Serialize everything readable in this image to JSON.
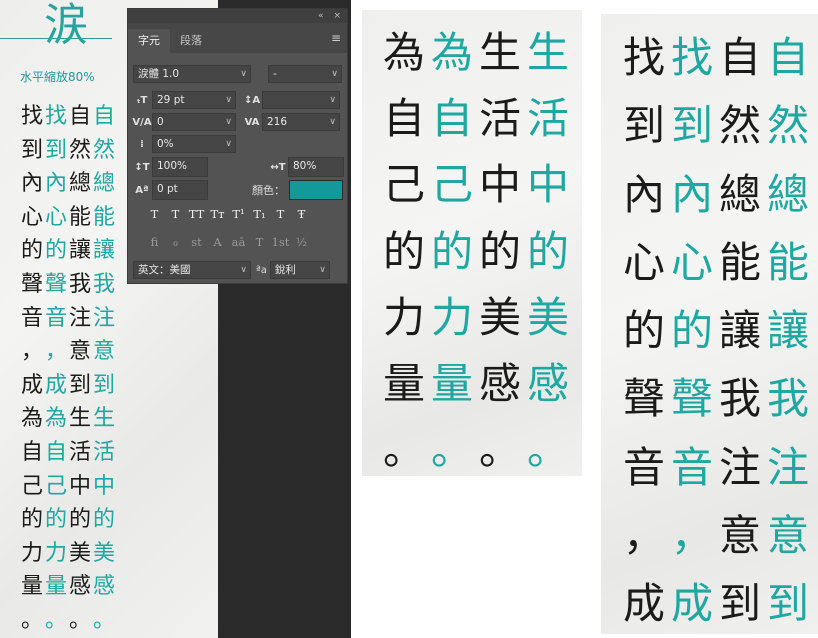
{
  "logo": {
    "glyph": "涙",
    "subtitle": "水平縮放80%"
  },
  "panel": {
    "collapse_icon": "«",
    "close_icon": "×",
    "tabs": [
      {
        "label": "字元"
      },
      {
        "label": "段落"
      }
    ],
    "menu_icon": "≡",
    "font_family": "淚體 1.0",
    "font_style": "-",
    "font_size": "29 pt",
    "leading": "",
    "kerning": "0",
    "tracking": "216",
    "tsume": "0%",
    "vertical_scale": "100%",
    "horizontal_scale": "80%",
    "baseline_shift": "0 pt",
    "color_label": "顏色：",
    "color_value": "#13999a",
    "style_buttons": [
      "T",
      "T",
      "TT",
      "Tт",
      "T¹",
      "T₁",
      "T",
      "Ŧ"
    ],
    "feature_buttons": [
      "fi",
      "ℴ",
      "st",
      "A",
      "aā",
      "T",
      "1st",
      "½"
    ],
    "language": "英文：美國",
    "aa_label": "ªa",
    "antialias": "銳利",
    "icons": {
      "font_size": "font-size-icon",
      "leading": "leading-icon",
      "kerning": "kerning-icon",
      "tracking": "tracking-icon",
      "tsume": "tsume-icon",
      "vertical_scale": "vertical-scale-icon",
      "horizontal_scale": "horizontal-scale-icon",
      "baseline_shift": "baseline-shift-icon"
    }
  },
  "small_sample": {
    "columns": [
      [
        "找",
        "到",
        "內",
        "心",
        "的",
        "聲",
        "音",
        "，",
        "成",
        "為",
        "自",
        "己",
        "的",
        "力",
        "量",
        "。"
      ],
      [
        "找",
        "到",
        "內",
        "心",
        "的",
        "聲",
        "音",
        "，",
        "成",
        "為",
        "自",
        "己",
        "的",
        "力",
        "量",
        "。"
      ],
      [
        "自",
        "然",
        "總",
        "能",
        "讓",
        "我",
        "注",
        "意",
        "到",
        "生",
        "活",
        "中",
        "的",
        "美",
        "感",
        "。"
      ],
      [
        "自",
        "然",
        "總",
        "能",
        "讓",
        "我",
        "注",
        "意",
        "到",
        "生",
        "活",
        "中",
        "的",
        "美",
        "感",
        "。"
      ]
    ]
  },
  "mid_sample": {
    "columns": [
      [
        "為",
        "自",
        "己",
        "的",
        "力",
        "量",
        "。"
      ],
      [
        "為",
        "自",
        "己",
        "的",
        "力",
        "量",
        "。"
      ],
      [
        "生",
        "活",
        "中",
        "的",
        "美",
        "感",
        "。"
      ],
      [
        "生",
        "活",
        "中",
        "的",
        "美",
        "感",
        "。"
      ]
    ]
  },
  "right_sample": {
    "columns": [
      [
        "找",
        "到",
        "內",
        "心",
        "的",
        "聲",
        "音",
        "，",
        "成"
      ],
      [
        "找",
        "到",
        "內",
        "心",
        "的",
        "聲",
        "音",
        "，",
        "成"
      ],
      [
        "自",
        "然",
        "總",
        "能",
        "讓",
        "我",
        "注",
        "意",
        "到"
      ],
      [
        "自",
        "然",
        "總",
        "能",
        "讓",
        "我",
        "注",
        "意",
        "到"
      ]
    ]
  },
  "colors": {
    "teal": "#1fa7a2",
    "black": "#1b1b1b",
    "panel_bg": "#535353"
  }
}
